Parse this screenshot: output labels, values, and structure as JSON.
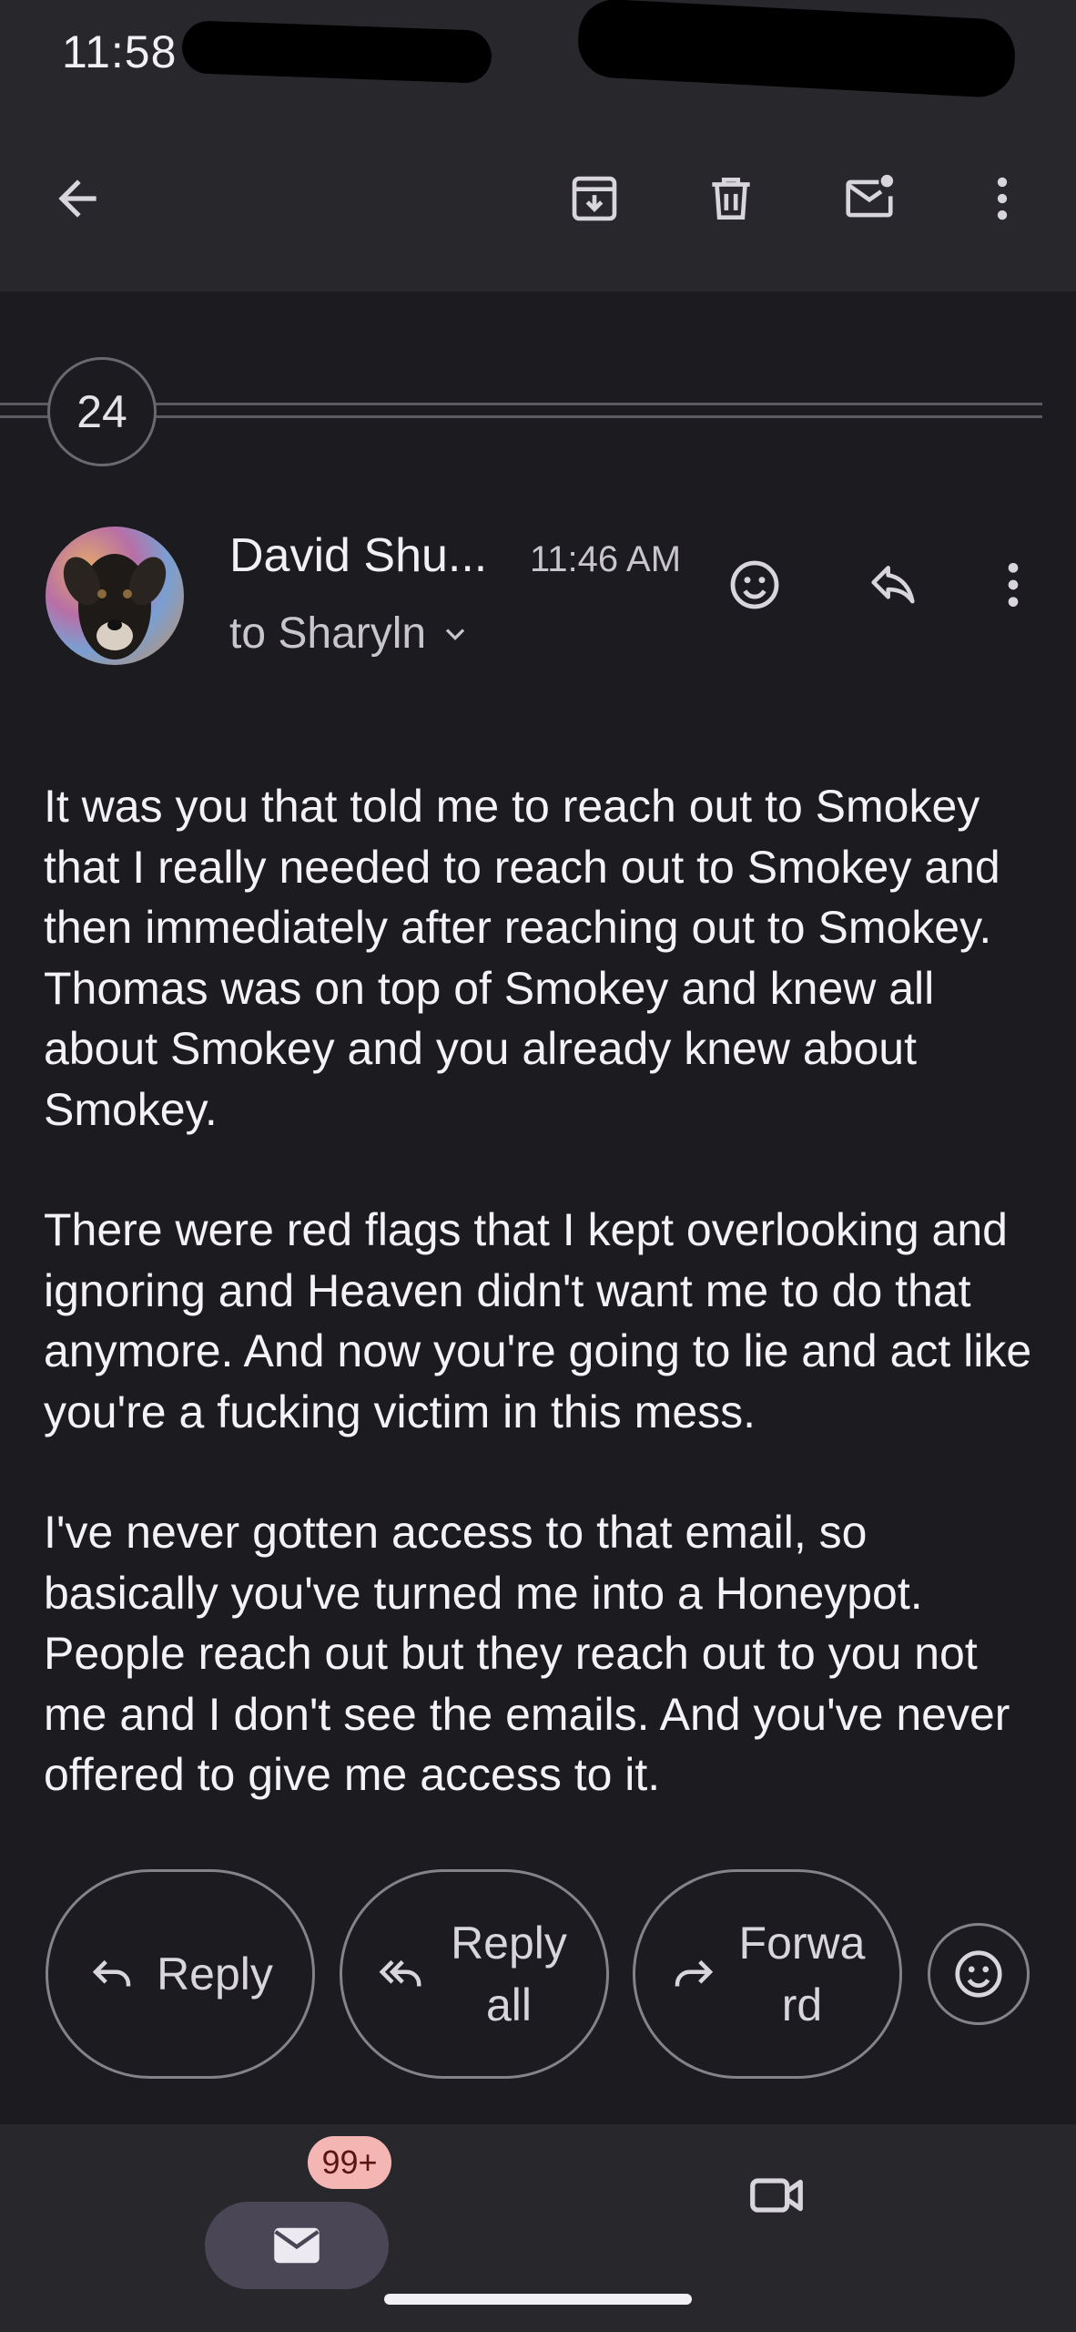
{
  "status_bar": {
    "time": "11:58"
  },
  "toolbar": {
    "back_icon": "arrow-back-icon",
    "archive_icon": "archive-icon",
    "delete_icon": "trash-icon",
    "mark_unread_icon": "mark-unread-icon",
    "more_icon": "more-vert-icon"
  },
  "thread": {
    "count": "24"
  },
  "message": {
    "sender": "David Shu...",
    "time": "11:46 AM",
    "recipient": "to Sharyln",
    "body": [
      "It was you that told me to reach out to Smokey that I really needed to reach out to Smokey and then immediately after reaching out to Smokey. Thomas was on top of Smokey and knew all about Smokey and you already knew about Smokey.",
      "There were red flags that I kept overlooking and ignoring and Heaven didn't want me to do that anymore. And now you're going to lie and act like you're a fucking victim in this mess.",
      "I've never gotten access to that email, so basically you've turned me into a Honeypot. People reach out but they reach out to you not me and I don't see the emails. And you've never offered to give me access to it."
    ]
  },
  "actions": {
    "reply": "Reply",
    "reply_all": "Reply all",
    "forward": "Forwa rd"
  },
  "bottom_nav": {
    "mail_badge": "99+"
  },
  "colors": {
    "background": "#1c1b20",
    "bar": "#28272c",
    "badge": "#f4b6b3",
    "nav_pill": "#4a4656"
  }
}
